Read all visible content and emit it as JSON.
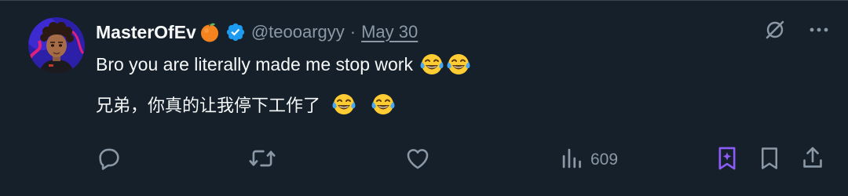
{
  "tweet": {
    "author": {
      "display_name": "MasterOfEv",
      "name_emoji": "orange",
      "verified": true,
      "handle": "@teooargyy",
      "separator": "·",
      "date": "May 30"
    },
    "text_line_1": "Bro you are literally made me stop work",
    "text_line_2": "兄弟，你真的让我停下工作了",
    "emoji": "face-with-tears-of-joy",
    "metrics": {
      "views": "609"
    }
  },
  "icons": {
    "top": [
      "grok-icon",
      "more-icon"
    ],
    "actions": [
      "reply-icon",
      "retweet-icon",
      "like-icon",
      "views-icon",
      "grok-bookmark-icon",
      "bookmark-icon",
      "share-icon"
    ]
  },
  "colors": {
    "background": "#15202b",
    "text": "#f7f9f9",
    "muted": "#8b98a5",
    "verified": "#1d9bf0",
    "highlight_icon": "#8b5cf6",
    "emoji_yellow": "#ffcc33",
    "orange": "#f5841f"
  }
}
